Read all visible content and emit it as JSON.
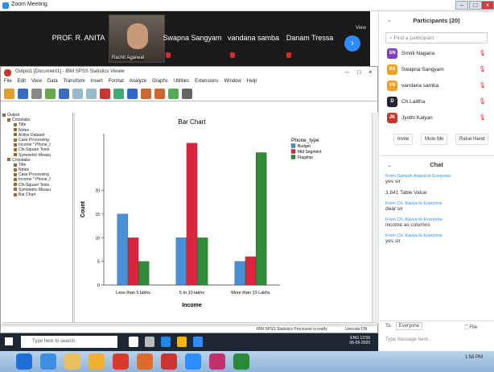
{
  "zoom": {
    "title": "Zoom Meeting"
  },
  "gallery": {
    "participants": [
      {
        "name": "PROF. R. ANITA"
      },
      {
        "name": "Swapna Sangyam"
      },
      {
        "name": "vandana samba"
      },
      {
        "name": "Danam Tressa"
      }
    ],
    "video_label": "Rachit Agarwal",
    "view_label": "View"
  },
  "spss": {
    "title": "Output1 [Document1] - IBM SPSS Statistics Viewer",
    "menu": [
      "File",
      "Edit",
      "View",
      "Data",
      "Transform",
      "Insert",
      "Format",
      "Analyze",
      "Graphs",
      "Utilities",
      "Extensions",
      "Window",
      "Help"
    ],
    "outline": [
      "Output",
      "Crosstabs",
      "Title",
      "Notes",
      "Active Dataset",
      "Case Processing",
      "Income * Phone_t",
      "Chi-Square Tests",
      "Symmetric Measu",
      "Crosstabs",
      "Title",
      "Notes",
      "Case Processing",
      "Income * Phone_t",
      "Chi-Square Tests",
      "Symmetric Measu",
      "Bar Chart"
    ],
    "status_processor": "IBM SPSS Statistics Processor is ready",
    "status_unicode": "Unicode:ON"
  },
  "chart_data": {
    "type": "bar",
    "title": "Bar Chart",
    "categories": [
      "Less than 5 lakhs",
      "5 to 10 lakhs",
      "More than 10 Lakhs"
    ],
    "series": [
      {
        "name": "Budget",
        "color": "#4a90d9",
        "values": [
          15,
          10,
          5
        ]
      },
      {
        "name": "Mid Segment",
        "color": "#d7263d",
        "values": [
          10,
          30,
          6
        ]
      },
      {
        "name": "Flagship",
        "color": "#2e8b3a",
        "values": [
          5,
          10,
          28
        ]
      }
    ],
    "xlabel": "Income",
    "ylabel": "Count",
    "yticks": [
      0,
      5,
      10,
      15,
      20
    ],
    "ytick_labels": [
      "0",
      "5",
      "10",
      "15",
      "20"
    ],
    "ylim": [
      0,
      32
    ],
    "legend_title": "Phone_type",
    "legend_position": "top-right",
    "grid": false
  },
  "panel": {
    "title": "Participants (20)",
    "search_placeholder": "Find a participant",
    "participants": [
      {
        "initials": "SN",
        "name": "Smriti Nagaria",
        "color": "#7b3fbf"
      },
      {
        "initials": "SS",
        "name": "Swapna Sangyam",
        "color": "#f0a020"
      },
      {
        "initials": "VS",
        "name": "vandana samba",
        "color": "#f0a020"
      },
      {
        "initials": "D",
        "name": "Ch.Lalitha",
        "color": "#223"
      },
      {
        "initials": "JK",
        "name": "Jyothi Kalyan",
        "color": "#c0392b"
      }
    ],
    "buttons": [
      "Invite",
      "Mute Me",
      "Raise Hand"
    ],
    "chat_title": "Chat",
    "messages": [
      {
        "from": "From Ganesh Anand to Everyone",
        "text": "yes sir"
      },
      {
        "from": "",
        "text": "3.841 Table Value"
      },
      {
        "from": "From Ch. Kavya to Everyone",
        "text": "dear sir"
      },
      {
        "from": "From Ch. Kavya to Everyone",
        "text": "income as columns"
      },
      {
        "from": "From Ch. Kavya to Everyone",
        "text": "yes sir"
      }
    ],
    "to_label": "To:",
    "to_value": "Everyone",
    "file_label": "File",
    "input_placeholder": "Type message here..."
  },
  "taskbar": {
    "search_placeholder": "Type here to search",
    "time": "13:56",
    "date": "06-09-2020",
    "lang": "ENG"
  },
  "taskbar2": {
    "time": "1:58 PM"
  }
}
